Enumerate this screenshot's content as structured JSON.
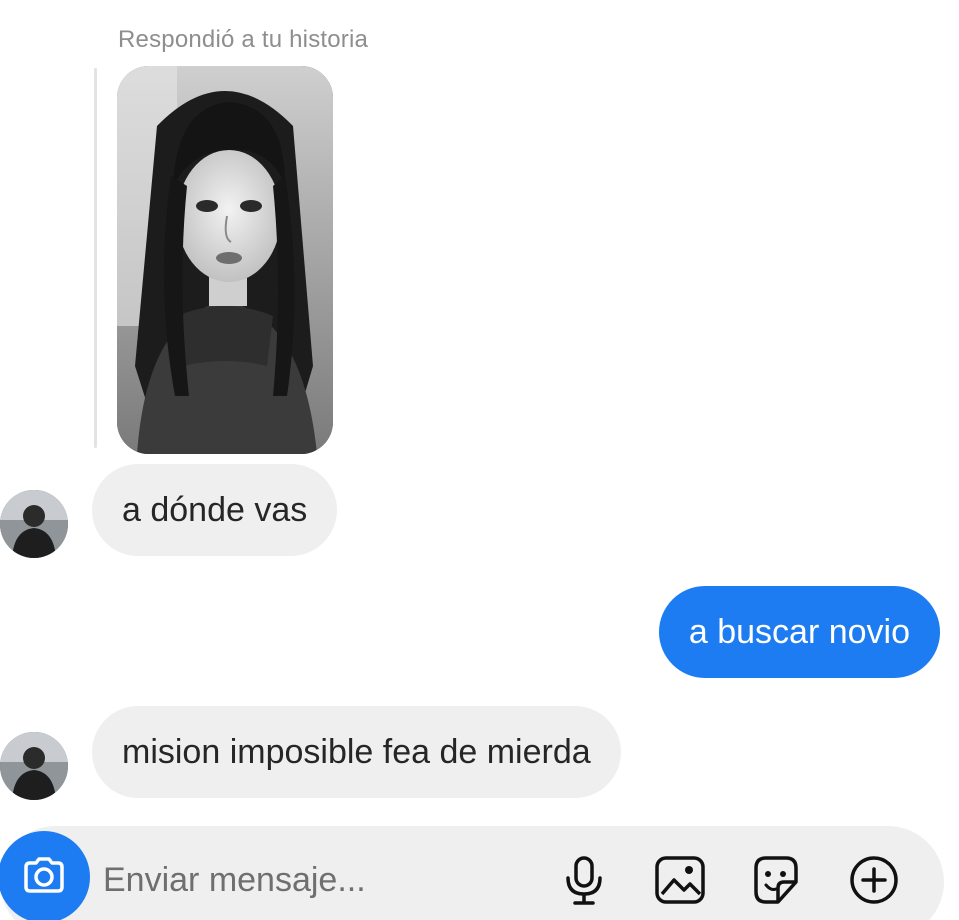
{
  "story": {
    "caption": "Respondió a tu historia"
  },
  "messages": [
    {
      "direction": "incoming",
      "text": "a dónde vas"
    },
    {
      "direction": "outgoing",
      "text": "a buscar novio"
    },
    {
      "direction": "incoming",
      "text": "mision imposible fea de mierda"
    }
  ],
  "composer": {
    "placeholder": "Enviar mensaje...",
    "icons": [
      "camera-icon",
      "microphone-icon",
      "gallery-icon",
      "sticker-icon",
      "plus-circle-icon"
    ]
  },
  "colors": {
    "accent": "#1d7cf2",
    "incoming_bubble": "#efefef",
    "caption_text": "#8e8e8e"
  }
}
